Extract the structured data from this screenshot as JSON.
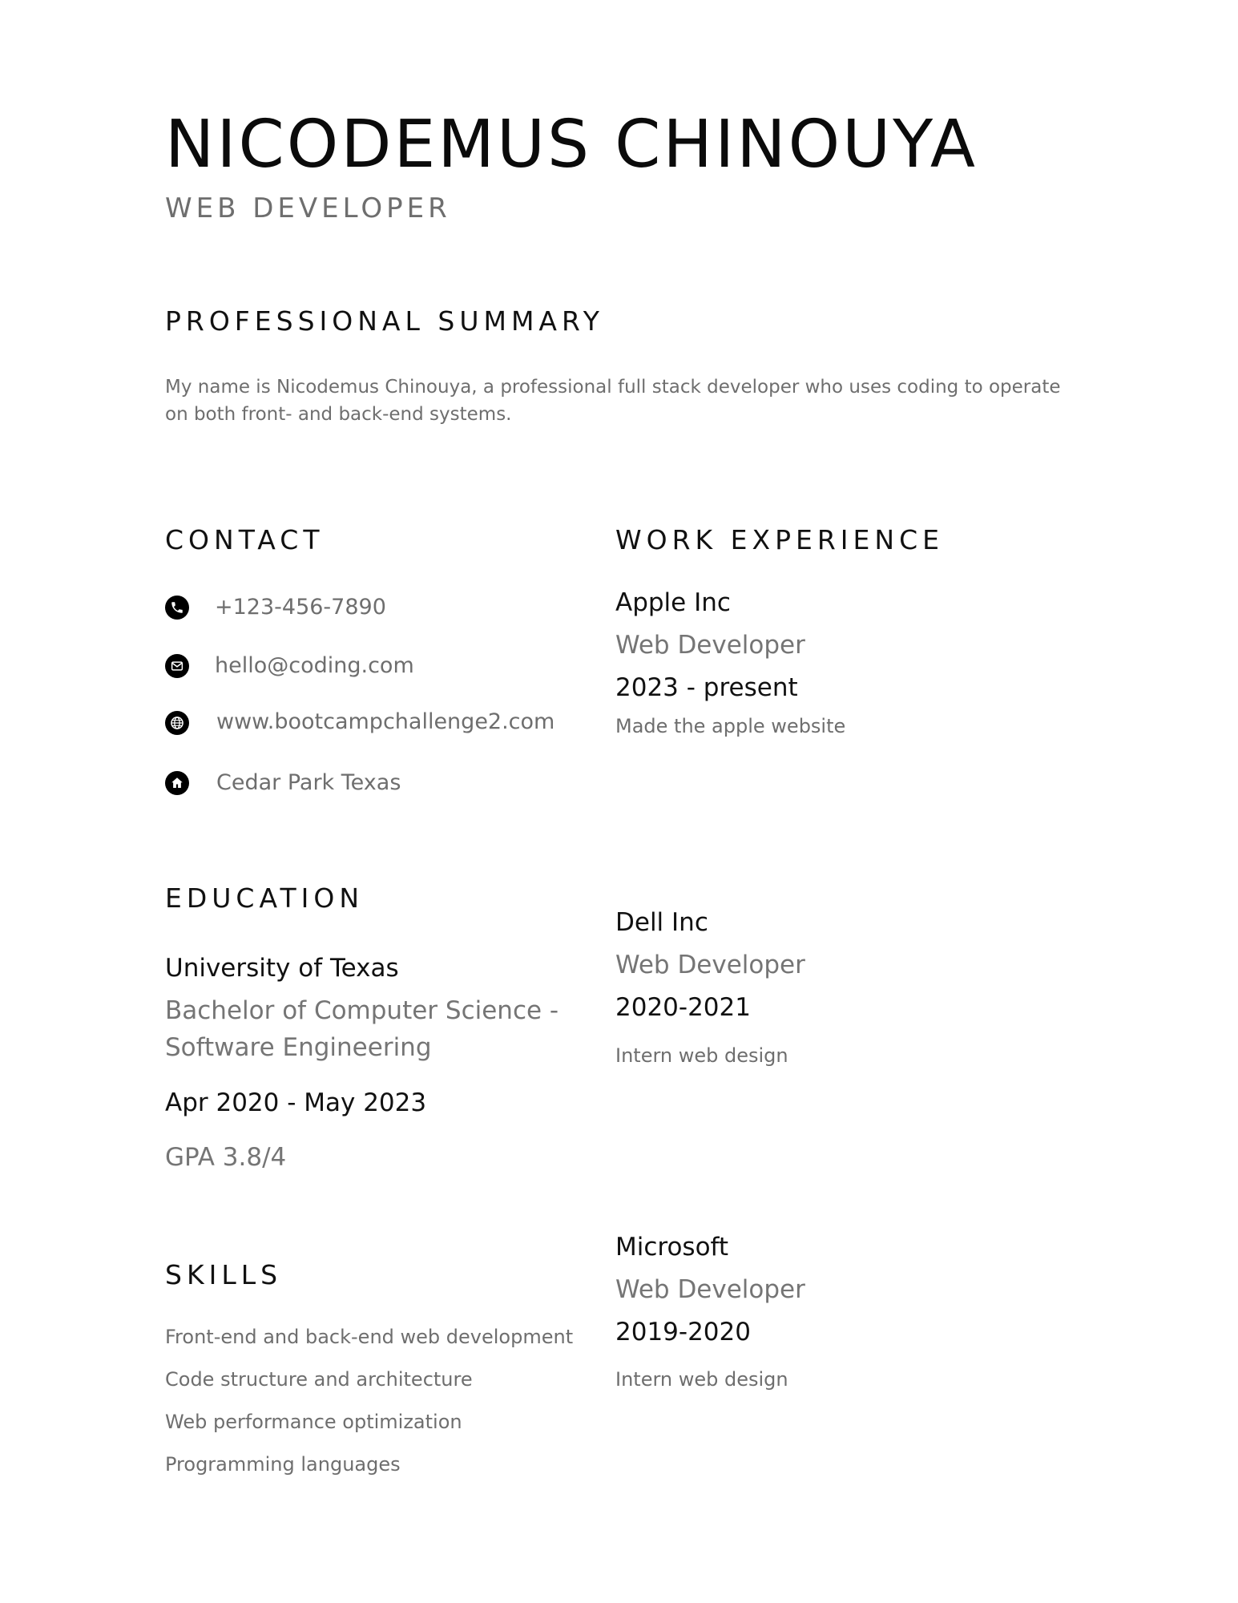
{
  "header": {
    "name": "NICODEMUS CHINOUYA",
    "title": "WEB DEVELOPER"
  },
  "summary": {
    "heading": "PROFESSIONAL SUMMARY",
    "text": "My name is Nicodemus Chinouya, a professional full stack developer who uses coding to operate on both front- and back-end systems."
  },
  "contact": {
    "heading": "CONTACT",
    "items": [
      {
        "icon": "phone-icon",
        "text": "+123-456-7890"
      },
      {
        "icon": "email-icon",
        "text": "hello@coding.com"
      },
      {
        "icon": "globe-icon",
        "text": "www.bootcampchallenge2.com"
      },
      {
        "icon": "home-icon",
        "text": "Cedar Park Texas"
      }
    ]
  },
  "education": {
    "heading": "EDUCATION",
    "school": "University of Texas",
    "degree": "Bachelor of Computer Science - Software Engineering",
    "dates": "Apr 2020 - May 2023",
    "gpa": "GPA 3.8/4"
  },
  "skills": {
    "heading": "SKILLS",
    "items": [
      "Front-end and back-end web development",
      "Code structure and architecture",
      "Web performance optimization",
      "Programming languages"
    ]
  },
  "work": {
    "heading": "WORK EXPERIENCE",
    "jobs": [
      {
        "company": "Apple Inc",
        "role": "Web Developer",
        "period": "2023 - present",
        "description": "Made the apple website"
      },
      {
        "company": "Dell Inc",
        "role": "Web Developer",
        "period": "2020-2021",
        "description": "Intern web design"
      },
      {
        "company": "Microsoft",
        "role": "Web Developer",
        "period": "2019-2020",
        "description": "Intern web design"
      }
    ]
  }
}
